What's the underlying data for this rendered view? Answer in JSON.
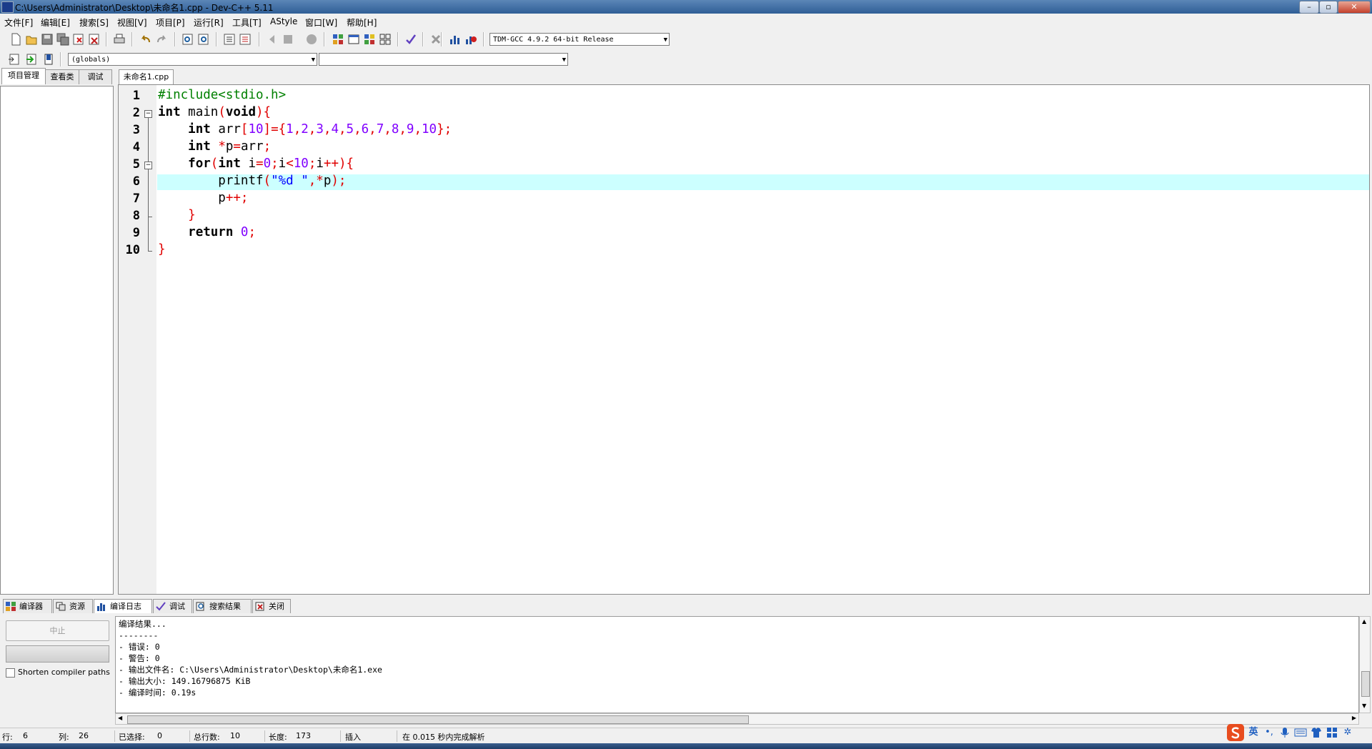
{
  "window": {
    "title": "C:\\Users\\Administrator\\Desktop\\未命名1.cpp - Dev-C++ 5.11"
  },
  "menu": [
    "文件[F]",
    "编辑[E]",
    "搜索[S]",
    "视图[V]",
    "项目[P]",
    "运行[R]",
    "工具[T]",
    "AStyle",
    "窗口[W]",
    "帮助[H]"
  ],
  "toolbar": {
    "compiler": "TDM-GCC 4.9.2 64-bit Release",
    "scope": "(globals)",
    "symbol": ""
  },
  "left_tabs": [
    "项目管理",
    "查看类",
    "调试"
  ],
  "editor": {
    "tab": "未命名1.cpp",
    "line_numbers": [
      "1",
      "2",
      "3",
      "4",
      "5",
      "6",
      "7",
      "8",
      "9",
      "10"
    ],
    "current_line": 6
  },
  "bottom_tabs": [
    "编译器",
    "资源",
    "编译日志",
    "调试",
    "搜索结果",
    "关闭"
  ],
  "compile": {
    "abort_label": "中止",
    "shorten_label": "Shorten compiler paths",
    "log": [
      "编译结果...",
      "--------",
      "- 错误: 0",
      "- 警告: 0",
      "- 输出文件名: C:\\Users\\Administrator\\Desktop\\未命名1.exe",
      "- 输出大小: 149.16796875 KiB",
      "- 编译时间: 0.19s"
    ]
  },
  "status": {
    "line_label": "行:",
    "line": "6",
    "col_label": "列:",
    "col": "26",
    "sel_label": "已选择:",
    "sel": "0",
    "total_label": "总行数:",
    "total": "10",
    "len_label": "长度:",
    "len": "173",
    "mode": "插入",
    "parse": "在 0.015 秒内完成解析"
  },
  "ime": {
    "lang": "英"
  }
}
